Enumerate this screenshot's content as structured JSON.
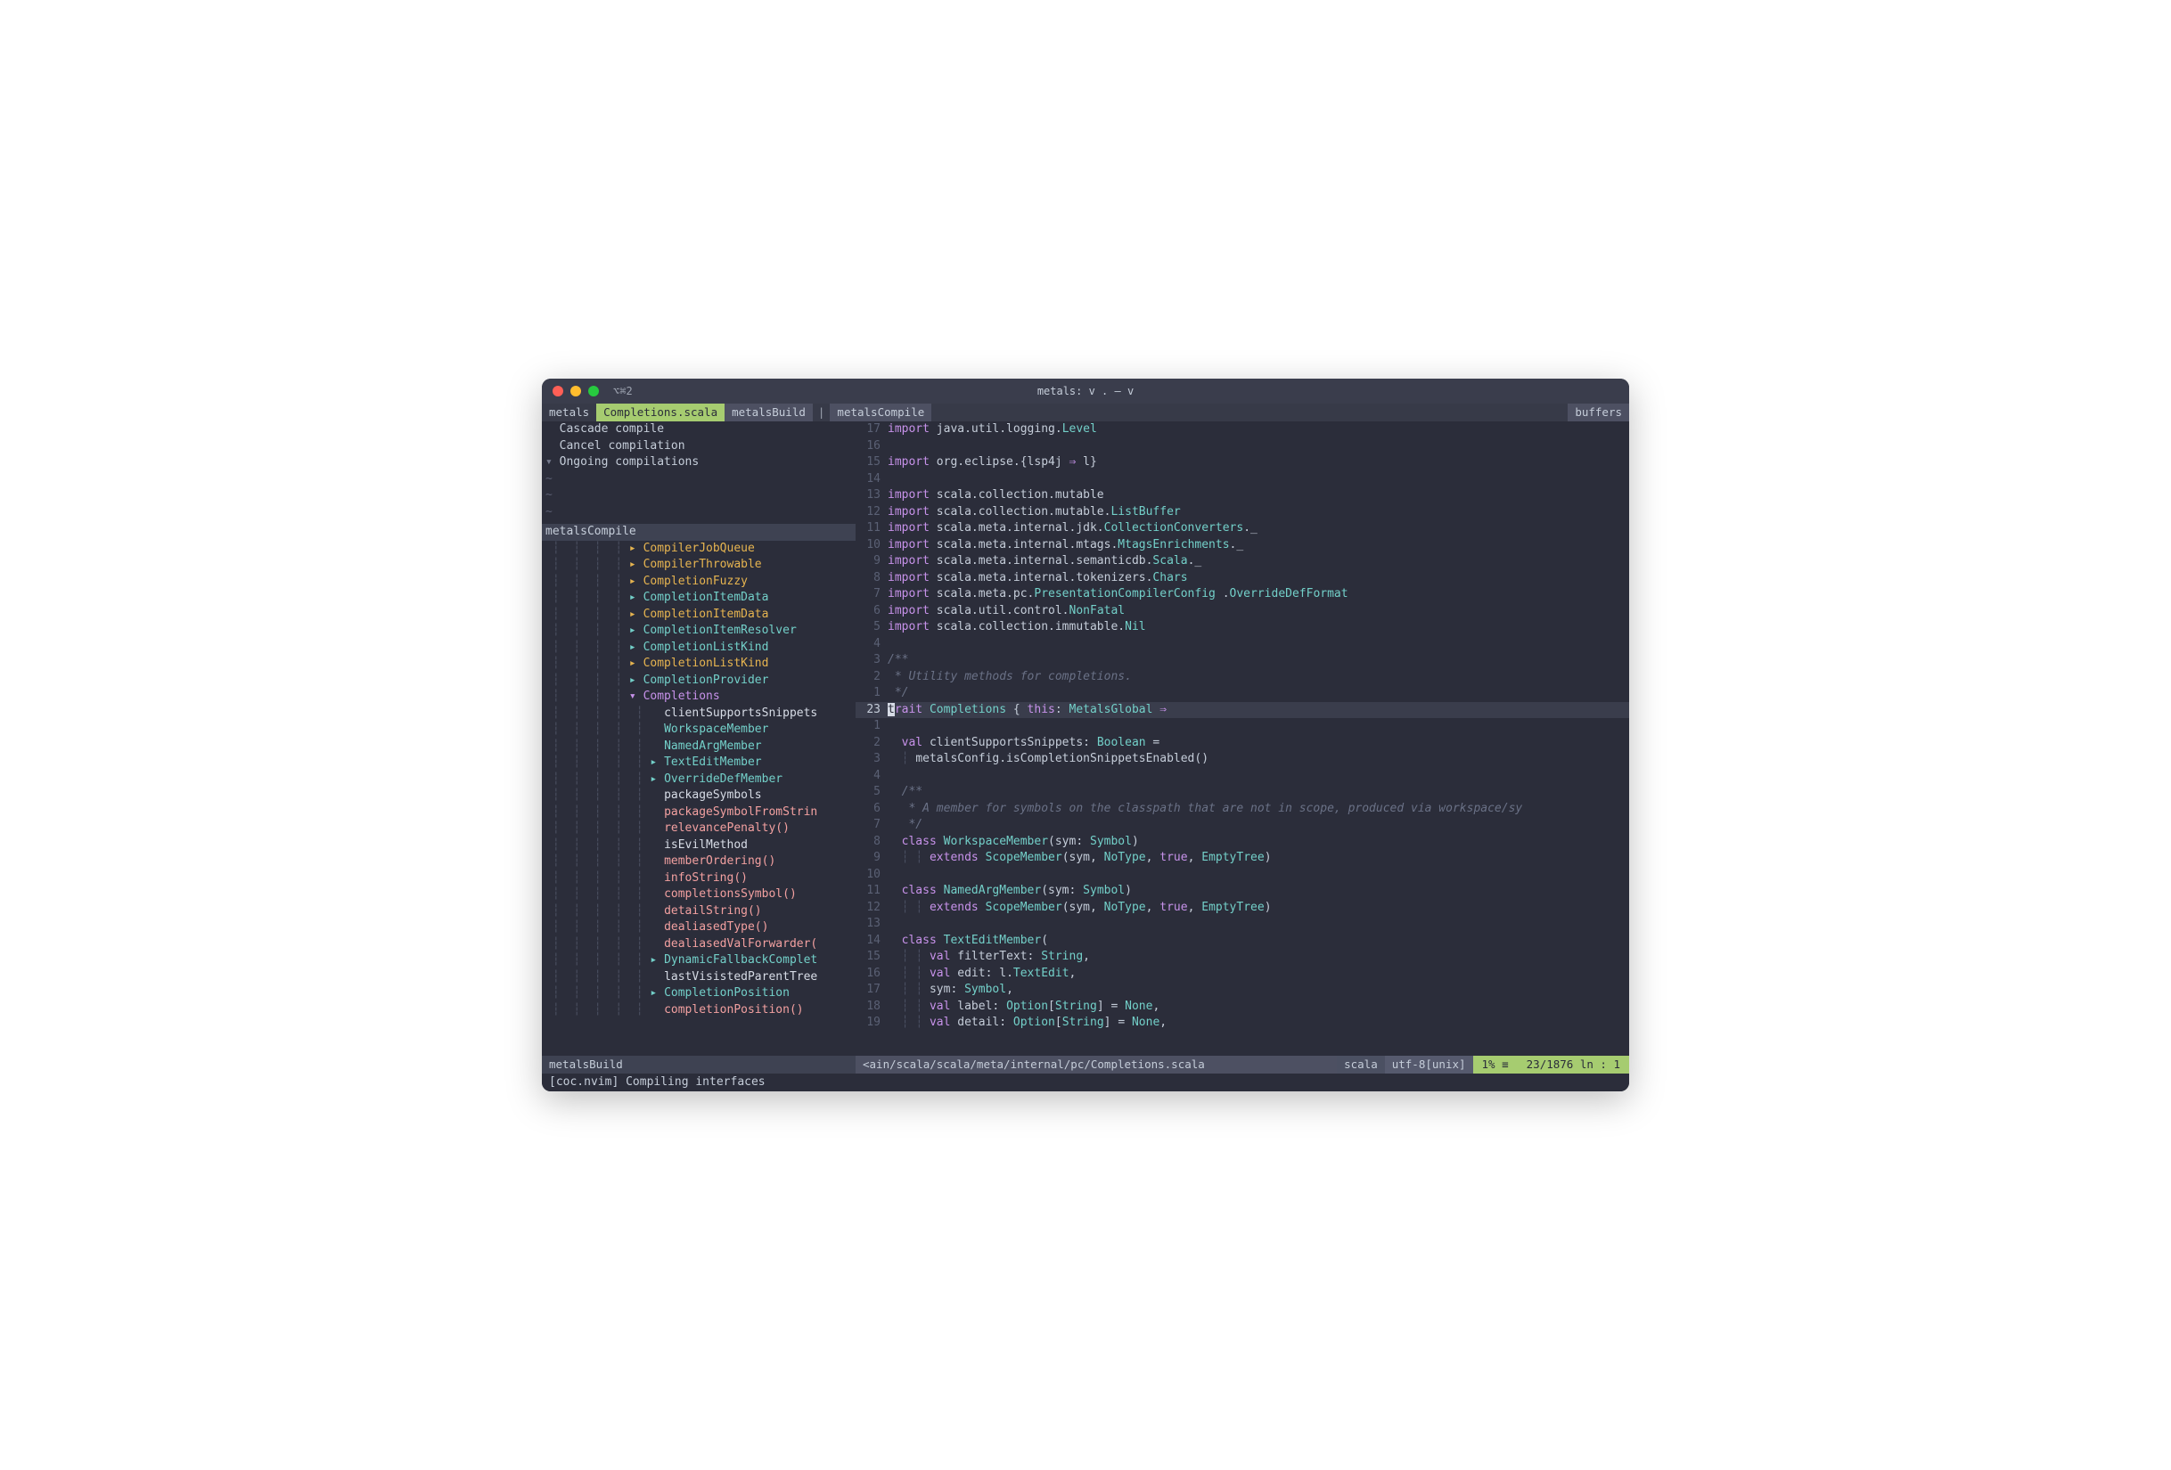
{
  "titlebar": {
    "hotkey": "⌥⌘2",
    "title": "metals: v . — v"
  },
  "tabs": {
    "leftLabel": "metals",
    "active": "Completions.scala",
    "second": "metalsBuild",
    "sep": "|",
    "third": "metalsCompile",
    "right": "buffers"
  },
  "sidebar": {
    "topItems": [
      "Cascade compile",
      "Cancel compilation",
      "Ongoing compilations"
    ],
    "outlineHeading": "metalsCompile",
    "tree": [
      {
        "indent": 4,
        "arrow": "right",
        "arrowColor": "yellow",
        "label": "CompilerJobQueue",
        "cls": "yellow"
      },
      {
        "indent": 4,
        "arrow": "right",
        "arrowColor": "yellow",
        "label": "CompilerThrowable",
        "cls": "yellow"
      },
      {
        "indent": 4,
        "arrow": "right",
        "arrowColor": "yellow",
        "label": "CompletionFuzzy",
        "cls": "yellow"
      },
      {
        "indent": 4,
        "arrow": "right",
        "arrowColor": "teal",
        "label": "CompletionItemData",
        "cls": "teal"
      },
      {
        "indent": 4,
        "arrow": "right",
        "arrowColor": "yellow",
        "label": "CompletionItemData",
        "cls": "yellow"
      },
      {
        "indent": 4,
        "arrow": "right",
        "arrowColor": "teal",
        "label": "CompletionItemResolver",
        "cls": "teal"
      },
      {
        "indent": 4,
        "arrow": "right",
        "arrowColor": "teal",
        "label": "CompletionListKind",
        "cls": "teal"
      },
      {
        "indent": 4,
        "arrow": "right",
        "arrowColor": "yellow",
        "label": "CompletionListKind",
        "cls": "yellow"
      },
      {
        "indent": 4,
        "arrow": "right",
        "arrowColor": "teal",
        "label": "CompletionProvider",
        "cls": "teal"
      },
      {
        "indent": 4,
        "arrow": "down",
        "arrowColor": "purple",
        "label": "Completions",
        "cls": "purple"
      },
      {
        "indent": 5,
        "arrow": "",
        "arrowColor": "",
        "label": "clientSupportsSnippets",
        "cls": "white"
      },
      {
        "indent": 5,
        "arrow": "",
        "arrowColor": "",
        "label": "WorkspaceMember",
        "cls": "teal"
      },
      {
        "indent": 5,
        "arrow": "",
        "arrowColor": "",
        "label": "NamedArgMember",
        "cls": "teal"
      },
      {
        "indent": 5,
        "arrow": "right",
        "arrowColor": "teal",
        "label": "TextEditMember",
        "cls": "teal"
      },
      {
        "indent": 5,
        "arrow": "right",
        "arrowColor": "teal",
        "label": "OverrideDefMember",
        "cls": "teal"
      },
      {
        "indent": 5,
        "arrow": "",
        "arrowColor": "",
        "label": "packageSymbols",
        "cls": "white"
      },
      {
        "indent": 5,
        "arrow": "",
        "arrowColor": "",
        "label": "packageSymbolFromStrin",
        "cls": "salmon"
      },
      {
        "indent": 5,
        "arrow": "",
        "arrowColor": "",
        "label": "relevancePenalty()",
        "cls": "salmon"
      },
      {
        "indent": 5,
        "arrow": "",
        "arrowColor": "",
        "label": "isEvilMethod",
        "cls": "white"
      },
      {
        "indent": 5,
        "arrow": "",
        "arrowColor": "",
        "label": "memberOrdering()",
        "cls": "salmon"
      },
      {
        "indent": 5,
        "arrow": "",
        "arrowColor": "",
        "label": "infoString()",
        "cls": "salmon"
      },
      {
        "indent": 5,
        "arrow": "",
        "arrowColor": "",
        "label": "completionsSymbol()",
        "cls": "salmon"
      },
      {
        "indent": 5,
        "arrow": "",
        "arrowColor": "",
        "label": "detailString()",
        "cls": "salmon"
      },
      {
        "indent": 5,
        "arrow": "",
        "arrowColor": "",
        "label": "dealiasedType()",
        "cls": "salmon"
      },
      {
        "indent": 5,
        "arrow": "",
        "arrowColor": "",
        "label": "dealiasedValForwarder(",
        "cls": "salmon"
      },
      {
        "indent": 5,
        "arrow": "right",
        "arrowColor": "teal",
        "label": "DynamicFallbackComplet",
        "cls": "teal"
      },
      {
        "indent": 5,
        "arrow": "",
        "arrowColor": "",
        "label": "lastVisistedParentTree",
        "cls": "white"
      },
      {
        "indent": 5,
        "arrow": "right",
        "arrowColor": "teal",
        "label": "CompletionPosition",
        "cls": "teal"
      },
      {
        "indent": 5,
        "arrow": "",
        "arrowColor": "",
        "label": "completionPosition()",
        "cls": "salmon"
      }
    ]
  },
  "code": [
    {
      "n": 17,
      "t": [
        [
          "kw",
          "import"
        ],
        [
          "",
          " java.util.logging."
        ],
        [
          "type",
          "Level"
        ]
      ]
    },
    {
      "n": 16,
      "t": []
    },
    {
      "n": 15,
      "t": [
        [
          "kw",
          "import"
        ],
        [
          "",
          " org.eclipse.{lsp4j "
        ],
        [
          "kw",
          "⇒"
        ],
        [
          "",
          " l}"
        ]
      ]
    },
    {
      "n": 14,
      "t": []
    },
    {
      "n": 13,
      "t": [
        [
          "kw",
          "import"
        ],
        [
          "",
          " scala.collection.mutable"
        ]
      ]
    },
    {
      "n": 12,
      "t": [
        [
          "kw",
          "import"
        ],
        [
          "",
          " scala.collection.mutable."
        ],
        [
          "type",
          "ListBuffer"
        ]
      ]
    },
    {
      "n": 11,
      "t": [
        [
          "kw",
          "import"
        ],
        [
          "",
          " scala.meta.internal.jdk."
        ],
        [
          "type",
          "CollectionConverters"
        ],
        [
          "",
          "._"
        ]
      ]
    },
    {
      "n": 10,
      "t": [
        [
          "kw",
          "import"
        ],
        [
          "",
          " scala.meta.internal.mtags."
        ],
        [
          "type",
          "MtagsEnrichments"
        ],
        [
          "",
          "._"
        ]
      ]
    },
    {
      "n": 9,
      "t": [
        [
          "kw",
          "import"
        ],
        [
          "",
          " scala.meta.internal.semanticdb."
        ],
        [
          "type",
          "Scala"
        ],
        [
          "",
          "._"
        ]
      ]
    },
    {
      "n": 8,
      "t": [
        [
          "kw",
          "import"
        ],
        [
          "",
          " scala.meta.internal.tokenizers."
        ],
        [
          "type",
          "Chars"
        ]
      ]
    },
    {
      "n": 7,
      "t": [
        [
          "kw",
          "import"
        ],
        [
          "",
          " scala.meta.pc."
        ],
        [
          "type",
          "PresentationCompilerConfig"
        ],
        [
          "",
          " ."
        ],
        [
          "type",
          "OverrideDefFormat"
        ]
      ]
    },
    {
      "n": 6,
      "t": [
        [
          "kw",
          "import"
        ],
        [
          "",
          " scala.util.control."
        ],
        [
          "type",
          "NonFatal"
        ]
      ]
    },
    {
      "n": 5,
      "t": [
        [
          "kw",
          "import"
        ],
        [
          "",
          " scala.collection.immutable."
        ],
        [
          "type",
          "Nil"
        ]
      ]
    },
    {
      "n": 4,
      "t": []
    },
    {
      "n": 3,
      "t": [
        [
          "comment",
          "/**"
        ]
      ]
    },
    {
      "n": 2,
      "t": [
        [
          "comment",
          " * Utility methods for completions."
        ]
      ]
    },
    {
      "n": 1,
      "t": [
        [
          "comment",
          " */"
        ]
      ]
    },
    {
      "n": 23,
      "cursor": true,
      "t": [
        [
          "cursor",
          "t"
        ],
        [
          "kw",
          "rait"
        ],
        [
          "",
          " "
        ],
        [
          "type",
          "Completions"
        ],
        [
          "",
          " { "
        ],
        [
          "kw",
          "this"
        ],
        [
          "",
          ": "
        ],
        [
          "type",
          "MetalsGlobal"
        ],
        [
          "",
          " "
        ],
        [
          "kw",
          "⇒"
        ]
      ]
    },
    {
      "n": 1,
      "t": []
    },
    {
      "n": 2,
      "t": [
        [
          "",
          "  "
        ],
        [
          "kw",
          "val"
        ],
        [
          "",
          " clientSupportsSnippets: "
        ],
        [
          "type",
          "Boolean"
        ],
        [
          "",
          " ="
        ]
      ]
    },
    {
      "n": 3,
      "t": [
        [
          "",
          "  "
        ],
        [
          "indent-guide",
          "┆ "
        ],
        [
          "",
          "metalsConfig.isCompletionSnippetsEnabled()"
        ]
      ]
    },
    {
      "n": 4,
      "t": []
    },
    {
      "n": 5,
      "t": [
        [
          "",
          "  "
        ],
        [
          "comment",
          "/**"
        ]
      ]
    },
    {
      "n": 6,
      "t": [
        [
          "",
          "  "
        ],
        [
          "comment",
          " * A member for symbols on the classpath that are not in scope, produced via workspace/sy"
        ]
      ]
    },
    {
      "n": 7,
      "t": [
        [
          "",
          "  "
        ],
        [
          "comment",
          " */"
        ]
      ]
    },
    {
      "n": 8,
      "t": [
        [
          "",
          "  "
        ],
        [
          "kw",
          "class"
        ],
        [
          "",
          " "
        ],
        [
          "type",
          "WorkspaceMember"
        ],
        [
          "",
          "(sym: "
        ],
        [
          "type",
          "Symbol"
        ],
        [
          "",
          ")"
        ]
      ]
    },
    {
      "n": 9,
      "t": [
        [
          "",
          "  "
        ],
        [
          "indent-guide",
          "┆ "
        ],
        [
          "indent-guide",
          "┆ "
        ],
        [
          "kw",
          "extends"
        ],
        [
          "",
          " "
        ],
        [
          "type",
          "ScopeMember"
        ],
        [
          "",
          "(sym, "
        ],
        [
          "type",
          "NoType"
        ],
        [
          "",
          ", "
        ],
        [
          "kw",
          "true"
        ],
        [
          "",
          ", "
        ],
        [
          "type",
          "EmptyTree"
        ],
        [
          "",
          ")"
        ]
      ]
    },
    {
      "n": 10,
      "t": []
    },
    {
      "n": 11,
      "t": [
        [
          "",
          "  "
        ],
        [
          "kw",
          "class"
        ],
        [
          "",
          " "
        ],
        [
          "type",
          "NamedArgMember"
        ],
        [
          "",
          "(sym: "
        ],
        [
          "type",
          "Symbol"
        ],
        [
          "",
          ")"
        ]
      ]
    },
    {
      "n": 12,
      "t": [
        [
          "",
          "  "
        ],
        [
          "indent-guide",
          "┆ "
        ],
        [
          "indent-guide",
          "┆ "
        ],
        [
          "kw",
          "extends"
        ],
        [
          "",
          " "
        ],
        [
          "type",
          "ScopeMember"
        ],
        [
          "",
          "(sym, "
        ],
        [
          "type",
          "NoType"
        ],
        [
          "",
          ", "
        ],
        [
          "kw",
          "true"
        ],
        [
          "",
          ", "
        ],
        [
          "type",
          "EmptyTree"
        ],
        [
          "",
          ")"
        ]
      ]
    },
    {
      "n": 13,
      "t": []
    },
    {
      "n": 14,
      "t": [
        [
          "",
          "  "
        ],
        [
          "kw",
          "class"
        ],
        [
          "",
          " "
        ],
        [
          "type",
          "TextEditMember"
        ],
        [
          "",
          "("
        ]
      ]
    },
    {
      "n": 15,
      "t": [
        [
          "",
          "  "
        ],
        [
          "indent-guide",
          "┆ "
        ],
        [
          "indent-guide",
          "┆ "
        ],
        [
          "kw",
          "val"
        ],
        [
          "",
          " filterText: "
        ],
        [
          "type",
          "String"
        ],
        [
          "",
          ","
        ]
      ]
    },
    {
      "n": 16,
      "t": [
        [
          "",
          "  "
        ],
        [
          "indent-guide",
          "┆ "
        ],
        [
          "indent-guide",
          "┆ "
        ],
        [
          "kw",
          "val"
        ],
        [
          "",
          " edit: l."
        ],
        [
          "type",
          "TextEdit"
        ],
        [
          "",
          ","
        ]
      ]
    },
    {
      "n": 17,
      "t": [
        [
          "",
          "  "
        ],
        [
          "indent-guide",
          "┆ "
        ],
        [
          "indent-guide",
          "┆ "
        ],
        [
          "",
          "sym: "
        ],
        [
          "type",
          "Symbol"
        ],
        [
          "",
          ","
        ]
      ]
    },
    {
      "n": 18,
      "t": [
        [
          "",
          "  "
        ],
        [
          "indent-guide",
          "┆ "
        ],
        [
          "indent-guide",
          "┆ "
        ],
        [
          "kw",
          "val"
        ],
        [
          "",
          " label: "
        ],
        [
          "type",
          "Option"
        ],
        [
          "",
          "["
        ],
        [
          "type",
          "String"
        ],
        [
          "",
          "] = "
        ],
        [
          "type",
          "None"
        ],
        [
          "",
          ","
        ]
      ]
    },
    {
      "n": 19,
      "t": [
        [
          "",
          "  "
        ],
        [
          "indent-guide",
          "┆ "
        ],
        [
          "indent-guide",
          "┆ "
        ],
        [
          "kw",
          "val"
        ],
        [
          "",
          " detail: "
        ],
        [
          "type",
          "Option"
        ],
        [
          "",
          "["
        ],
        [
          "type",
          "String"
        ],
        [
          "",
          "] = "
        ],
        [
          "type",
          "None"
        ],
        [
          "",
          ","
        ]
      ]
    }
  ],
  "status": {
    "left": "metalsBuild",
    "path": "<ain/scala/scala/meta/internal/pc/Completions.scala",
    "filetype": "scala",
    "encoding": "utf-8[unix]",
    "percent": "1% ≡",
    "position": "23/1876 ln :  1"
  },
  "message": "[coc.nvim] Compiling interfaces"
}
